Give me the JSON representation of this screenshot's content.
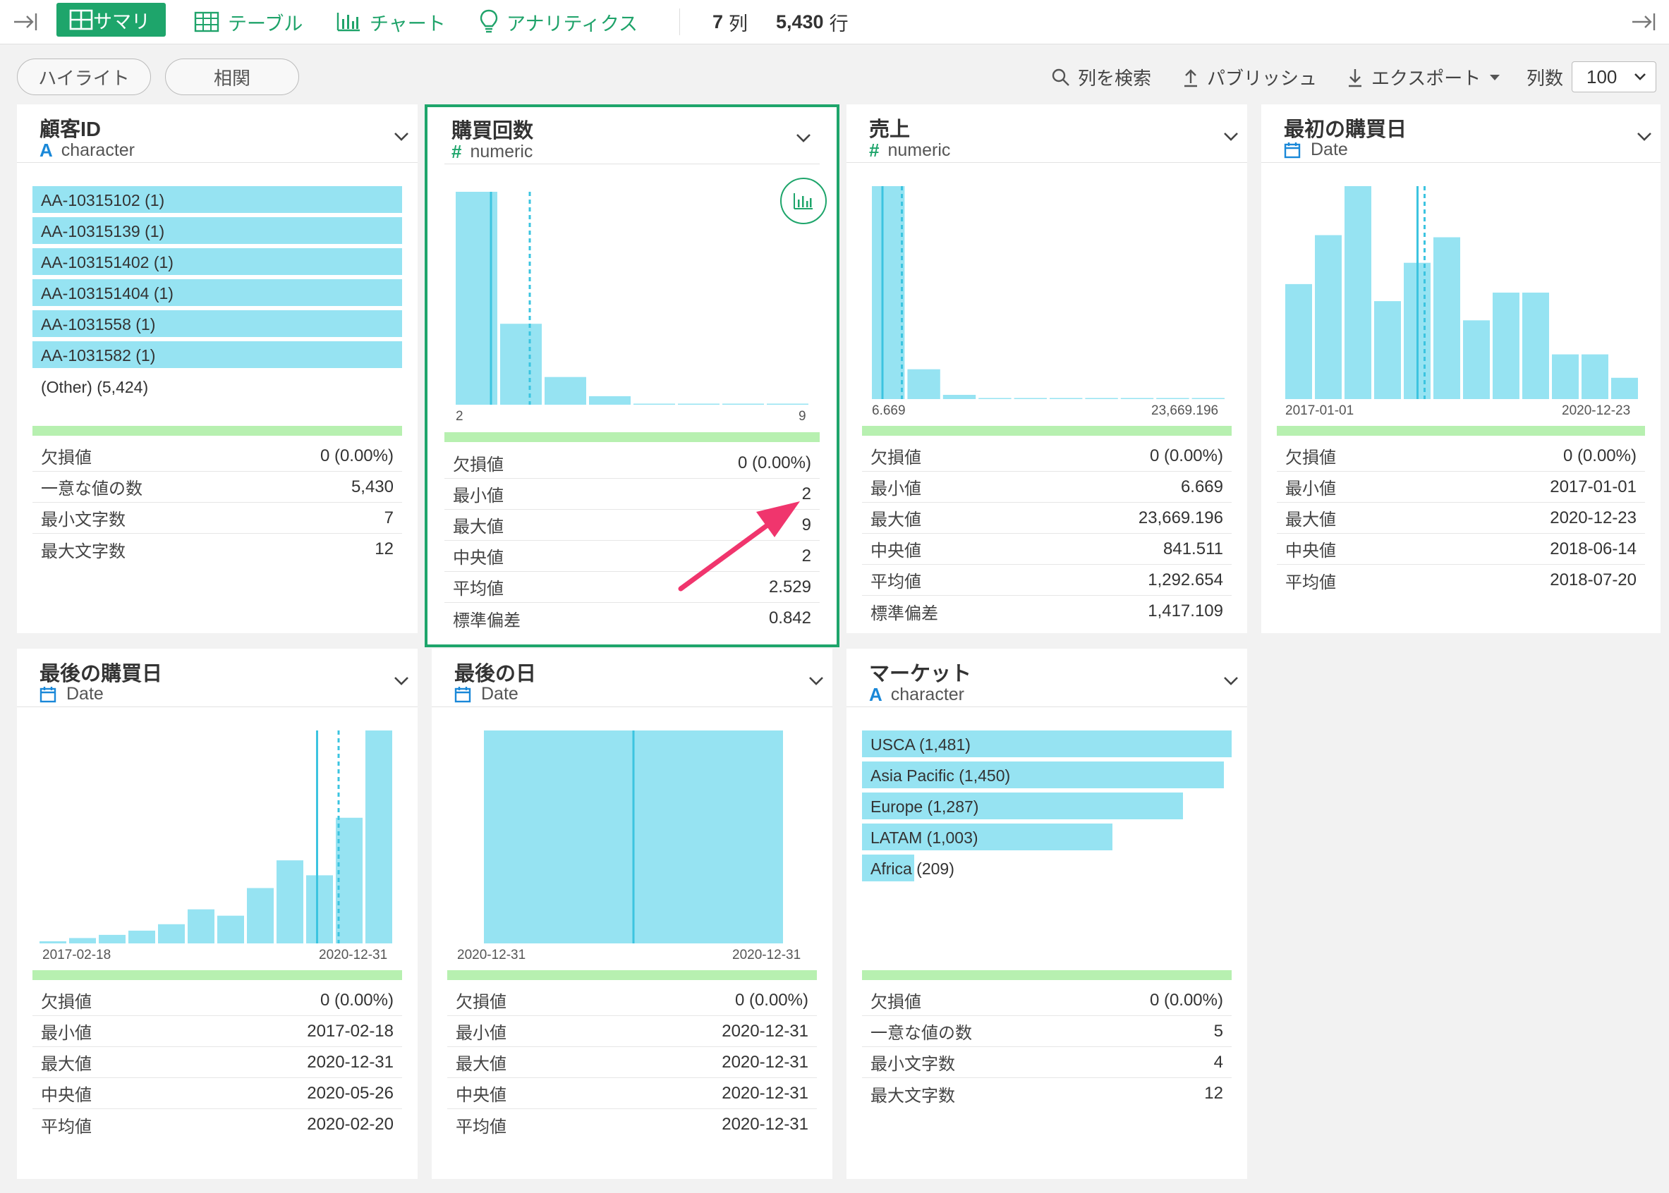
{
  "toolbar": {
    "tabs": [
      {
        "label": "サマリ",
        "icon": "grid-icon"
      },
      {
        "label": "テーブル",
        "icon": "table-icon"
      },
      {
        "label": "チャート",
        "icon": "bar-chart-icon"
      },
      {
        "label": "アナリティクス",
        "icon": "lightbulb-icon"
      }
    ],
    "col_count": "7",
    "col_unit": "列",
    "row_count": "5,430",
    "row_unit": "行"
  },
  "controls": {
    "highlight": "ハイライト",
    "correlation": "相関",
    "search_cols": "列を検索",
    "publish": "パブリッシュ",
    "export": "エクスポート",
    "cols_label": "列数",
    "cols_value": "100"
  },
  "colors": {
    "accent": "#1ea56b",
    "bar": "#96e3f2",
    "bar_line": "#3cc4e0",
    "sep_bar": "#b7f0b0",
    "arrow": "#f0356d"
  },
  "cards": [
    {
      "title": "顧客ID",
      "type_icon": "A",
      "type": "character",
      "items": [
        "AA-10315102 (1)",
        "AA-10315139 (1)",
        "AA-103151402 (1)",
        "AA-103151404 (1)",
        "AA-1031558 (1)",
        "AA-1031582 (1)"
      ],
      "other": "(Other) (5,424)",
      "stats": [
        [
          "欠損値",
          "0 (0.00%)"
        ],
        [
          "一意な値の数",
          "5,430"
        ],
        [
          "最小文字数",
          "7"
        ],
        [
          "最大文字数",
          "12"
        ]
      ]
    },
    {
      "title": "購買回数",
      "type_icon": "#",
      "type": "numeric",
      "chart_data": {
        "type": "bar",
        "values": [
          1.0,
          0.38,
          0.13,
          0.04,
          0.005,
          0.003,
          0.002,
          0.001
        ],
        "median_frac": 0.1,
        "mean_frac": 0.21,
        "xmin": "2",
        "xmax": "9"
      },
      "stats": [
        [
          "欠損値",
          "0 (0.00%)"
        ],
        [
          "最小値",
          "2"
        ],
        [
          "最大値",
          "9"
        ],
        [
          "中央値",
          "2"
        ],
        [
          "平均値",
          "2.529"
        ],
        [
          "標準偏差",
          "0.842"
        ]
      ]
    },
    {
      "title": "売上",
      "type_icon": "#",
      "type": "numeric",
      "chart_data": {
        "type": "bar",
        "values": [
          1.0,
          0.14,
          0.02,
          0.004,
          0.003,
          0.002,
          0.001,
          0.001,
          0.001,
          0.001
        ],
        "median_frac": 0.03,
        "mean_frac": 0.085,
        "xmin": "6.669",
        "xmax": "23,669.196"
      },
      "stats": [
        [
          "欠損値",
          "0 (0.00%)"
        ],
        [
          "最小値",
          "6.669"
        ],
        [
          "最大値",
          "23,669.196"
        ],
        [
          "中央値",
          "841.511"
        ],
        [
          "平均値",
          "1,292.654"
        ],
        [
          "標準偏差",
          "1,417.109"
        ]
      ]
    },
    {
      "title": "最初の購買日",
      "type_icon": "date",
      "type": "Date",
      "chart_data": {
        "type": "bar",
        "values": [
          0.54,
          0.77,
          1.0,
          0.46,
          0.64,
          0.76,
          0.37,
          0.5,
          0.5,
          0.21,
          0.21,
          0.1
        ],
        "median_frac": 0.375,
        "mean_frac": 0.395,
        "xmin": "2017-01-01",
        "xmax": "2020-12-23"
      },
      "stats": [
        [
          "欠損値",
          "0 (0.00%)"
        ],
        [
          "最小値",
          "2017-01-01"
        ],
        [
          "最大値",
          "2020-12-23"
        ],
        [
          "中央値",
          "2018-06-14"
        ],
        [
          "平均値",
          "2018-07-20"
        ]
      ]
    },
    {
      "title": "最後の購買日",
      "type_icon": "date",
      "type": "Date",
      "chart_data": {
        "type": "bar",
        "values": [
          0.01,
          0.025,
          0.04,
          0.06,
          0.09,
          0.16,
          0.13,
          0.26,
          0.39,
          0.32,
          0.59,
          1.0
        ],
        "median_frac": 0.787,
        "mean_frac": 0.848,
        "xmin": "2017-02-18",
        "xmax": "2020-12-31"
      },
      "stats": [
        [
          "欠損値",
          "0 (0.00%)"
        ],
        [
          "最小値",
          "2017-02-18"
        ],
        [
          "最大値",
          "2020-12-31"
        ],
        [
          "中央値",
          "2020-05-26"
        ],
        [
          "平均値",
          "2020-02-20"
        ]
      ]
    },
    {
      "title": "最後の日",
      "type_icon": "date",
      "type": "Date",
      "chart_data": {
        "type": "bar",
        "values": [
          1.0
        ],
        "median_frac": 0.5,
        "mean_frac": 0.5,
        "xmin": "2020-12-31",
        "xmax": "2020-12-31"
      },
      "stats": [
        [
          "欠損値",
          "0 (0.00%)"
        ],
        [
          "最小値",
          "2020-12-31"
        ],
        [
          "最大値",
          "2020-12-31"
        ],
        [
          "中央値",
          "2020-12-31"
        ],
        [
          "平均値",
          "2020-12-31"
        ]
      ]
    },
    {
      "title": "マーケット",
      "type_icon": "A",
      "type": "character",
      "items": [
        [
          "USCA (1,481)",
          1481
        ],
        [
          "Asia Pacific (1,450)",
          1450
        ],
        [
          "Europe (1,287)",
          1287
        ],
        [
          "LATAM (1,003)",
          1003
        ],
        [
          "Africa (209)",
          209
        ]
      ],
      "stats": [
        [
          "欠損値",
          "0 (0.00%)"
        ],
        [
          "一意な値の数",
          "5"
        ],
        [
          "最小文字数",
          "4"
        ],
        [
          "最大文字数",
          "12"
        ]
      ]
    }
  ]
}
